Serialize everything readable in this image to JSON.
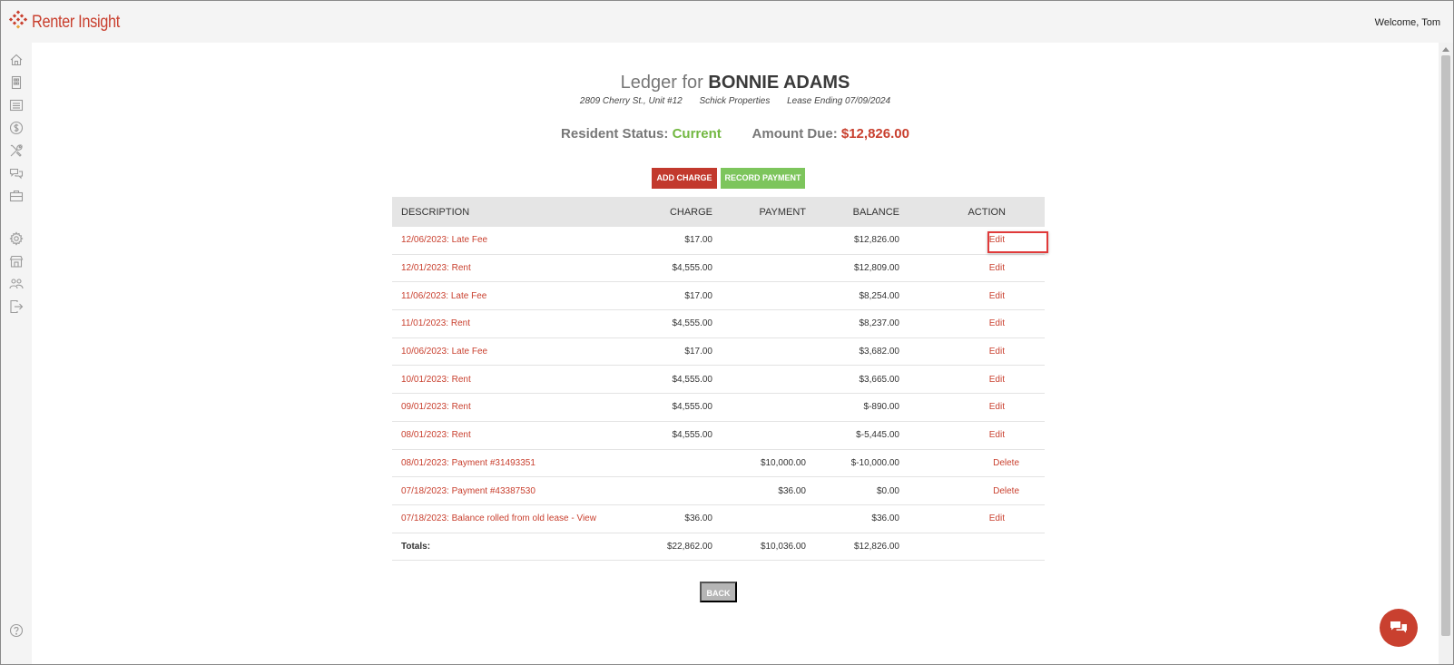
{
  "app": {
    "brand": "Renter Insight",
    "welcome": "Welcome, Tom",
    "brand_color": "#c9402f"
  },
  "sidebar": {
    "icons": [
      "home-icon",
      "building-icon",
      "list-icon",
      "dollar-icon",
      "tools-icon",
      "chat-bubbles-icon",
      "briefcase-icon",
      "gear-icon",
      "storefront-icon",
      "users-icon",
      "logout-icon",
      "help-icon"
    ]
  },
  "header": {
    "title_prefix": "Ledger for",
    "tenant_name": "BONNIE ADAMS",
    "address": "2809 Cherry St., Unit #12",
    "company": "Schick Properties",
    "lease_end": "Lease Ending 07/09/2024"
  },
  "status": {
    "status_label": "Resident Status:",
    "status_value": "Current",
    "due_label": "Amount Due:",
    "due_value": "$12,826.00"
  },
  "actions": {
    "add_charge": "ADD CHARGE",
    "record_payment": "RECORD PAYMENT",
    "back": "BACK"
  },
  "table": {
    "headers": {
      "description": "DESCRIPTION",
      "charge": "CHARGE",
      "payment": "PAYMENT",
      "balance": "BALANCE",
      "action": "ACTION"
    },
    "rows": [
      {
        "description": "12/06/2023: Late Fee",
        "charge": "$17.00",
        "payment": "",
        "balance": "$12,826.00",
        "action": "Edit"
      },
      {
        "description": "12/01/2023: Rent",
        "charge": "$4,555.00",
        "payment": "",
        "balance": "$12,809.00",
        "action": "Edit"
      },
      {
        "description": "11/06/2023: Late Fee",
        "charge": "$17.00",
        "payment": "",
        "balance": "$8,254.00",
        "action": "Edit"
      },
      {
        "description": "11/01/2023: Rent",
        "charge": "$4,555.00",
        "payment": "",
        "balance": "$8,237.00",
        "action": "Edit"
      },
      {
        "description": "10/06/2023: Late Fee",
        "charge": "$17.00",
        "payment": "",
        "balance": "$3,682.00",
        "action": "Edit"
      },
      {
        "description": "10/01/2023: Rent",
        "charge": "$4,555.00",
        "payment": "",
        "balance": "$3,665.00",
        "action": "Edit"
      },
      {
        "description": "09/01/2023: Rent",
        "charge": "$4,555.00",
        "payment": "",
        "balance": "$-890.00",
        "action": "Edit"
      },
      {
        "description": "08/01/2023: Rent",
        "charge": "$4,555.00",
        "payment": "",
        "balance": "$-5,445.00",
        "action": "Edit"
      },
      {
        "description": "08/01/2023: Payment #31493351",
        "charge": "",
        "payment": "$10,000.00",
        "balance": "$-10,000.00",
        "action": "Delete"
      },
      {
        "description": "07/18/2023: Payment #43387530",
        "charge": "",
        "payment": "$36.00",
        "balance": "$0.00",
        "action": "Delete"
      },
      {
        "description": "07/18/2023: Balance rolled from old lease - View",
        "charge": "$36.00",
        "payment": "",
        "balance": "$36.00",
        "action": "Edit"
      }
    ],
    "totals": {
      "label": "Totals:",
      "charge": "$22,862.00",
      "payment": "$10,036.00",
      "balance": "$12,826.00"
    }
  },
  "colors": {
    "add_charge_bg": "#c2392d",
    "record_payment_bg": "#7dc55c",
    "status_current": "#73b842",
    "amount_due": "#c9402f"
  }
}
